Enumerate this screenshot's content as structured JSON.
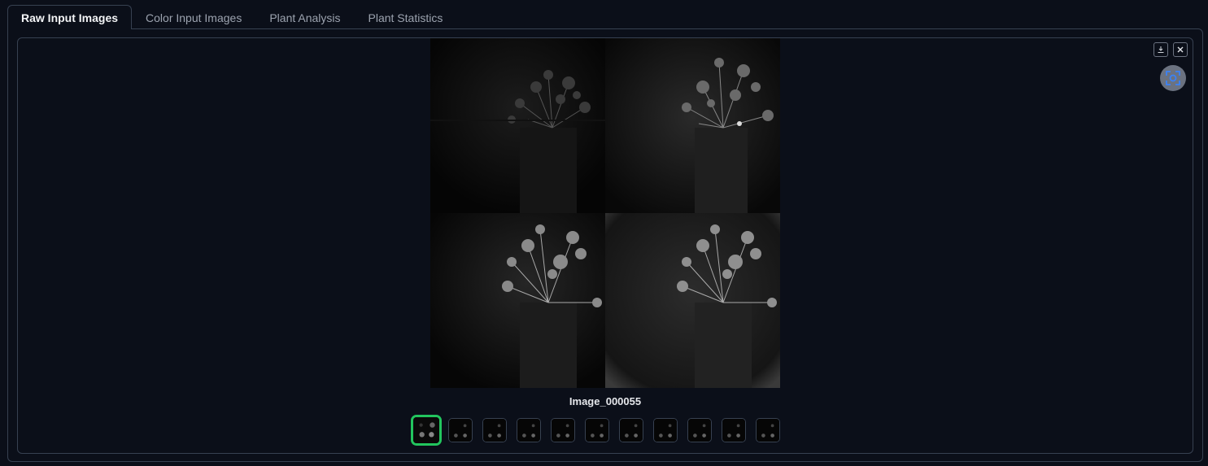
{
  "tabs": [
    {
      "label": "Raw Input Images",
      "active": true
    },
    {
      "label": "Color Input Images",
      "active": false
    },
    {
      "label": "Plant Analysis",
      "active": false
    },
    {
      "label": "Plant Statistics",
      "active": false
    }
  ],
  "gallery": {
    "caption": "Image_000055",
    "thumbnail_count": 11,
    "selected_index": 0,
    "selected_color": "#22c55e"
  },
  "toolbar": {
    "download_icon": "download-icon",
    "close_icon": "close-icon",
    "focus_icon": "focus-scan-icon"
  }
}
